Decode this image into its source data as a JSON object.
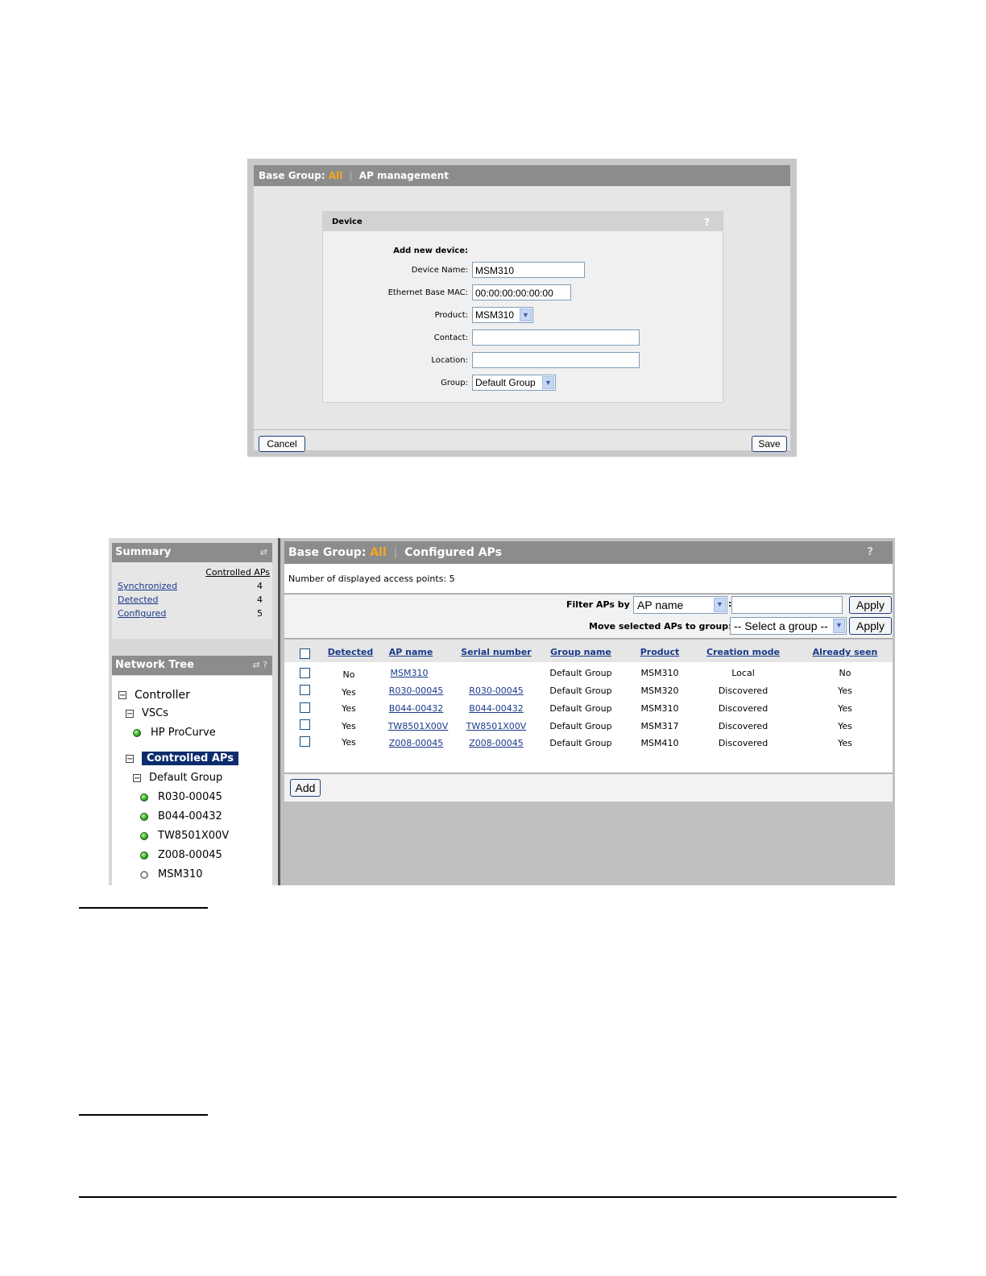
{
  "device_dialog": {
    "header": {
      "prefix": "Base Group:",
      "group": "All",
      "separator": "|",
      "title": "AP management"
    },
    "box_title": "Device",
    "help": "?",
    "section_title": "Add new device:",
    "fields": {
      "device_name": {
        "label": "Device Name:",
        "value": "MSM310"
      },
      "ethernet_mac": {
        "label": "Ethernet Base MAC:",
        "value": "00:00:00:00:00:00"
      },
      "product": {
        "label": "Product:",
        "value": "MSM310"
      },
      "contact": {
        "label": "Contact:",
        "value": ""
      },
      "location": {
        "label": "Location:",
        "value": ""
      },
      "group": {
        "label": "Group:",
        "value": "Default Group"
      }
    },
    "cancel_label": "Cancel",
    "save_label": "Save"
  },
  "summary": {
    "title": "Summary",
    "column_header": "Controlled APs",
    "rows": [
      {
        "label": "Synchronized",
        "value": "4"
      },
      {
        "label": "Detected",
        "value": "4"
      },
      {
        "label": "Configured",
        "value": "5"
      }
    ]
  },
  "network_tree": {
    "title": "Network Tree",
    "help": "?",
    "controller": "Controller",
    "vscs": "VSCs",
    "vsc_item": "HP ProCurve",
    "controlled_aps": "Controlled APs",
    "default_group": "Default Group",
    "aps": [
      {
        "name": "R030-00045",
        "status": "online"
      },
      {
        "name": "B044-00432",
        "status": "online"
      },
      {
        "name": "TW8501X00V",
        "status": "online"
      },
      {
        "name": "Z008-00045",
        "status": "online"
      },
      {
        "name": "MSM310",
        "status": "offline"
      }
    ]
  },
  "configured_aps": {
    "header": {
      "prefix": "Base Group:",
      "group": "All",
      "separator": "|",
      "title": "Configured APs"
    },
    "help": "?",
    "count_text": "Number of displayed access points: 5",
    "filter_label": "Filter APs by",
    "filter_select": "AP name",
    "colon": ":",
    "filter_value": "",
    "apply_label": "Apply",
    "move_label": "Move selected APs to group:",
    "move_select": "-- Select a group --",
    "columns": [
      "Detected",
      "AP name",
      "Serial number",
      "Group name",
      "Product",
      "Creation mode",
      "Already seen"
    ],
    "rows": [
      [
        "No",
        "MSM310",
        "",
        "Default Group",
        "MSM310",
        "Local",
        "No"
      ],
      [
        "Yes",
        "R030-00045",
        "R030-00045",
        "Default Group",
        "MSM320",
        "Discovered",
        "Yes"
      ],
      [
        "Yes",
        "B044-00432",
        "B044-00432",
        "Default Group",
        "MSM310",
        "Discovered",
        "Yes"
      ],
      [
        "Yes",
        "TW8501X00V",
        "TW8501X00V",
        "Default Group",
        "MSM317",
        "Discovered",
        "Yes"
      ],
      [
        "Yes",
        "Z008-00045",
        "Z008-00045",
        "Default Group",
        "MSM410",
        "Discovered",
        "Yes"
      ]
    ],
    "add_label": "Add"
  },
  "icons": {
    "help": "question-mark-icon",
    "panel_toggle": "panel-toggle-icon",
    "dropdown": "chevron-down-icon",
    "status_online": "green-status-dot-icon",
    "status_offline": "grey-status-dot-icon",
    "collapse": "collapse-minus-icon"
  },
  "colors": {
    "header_gray": "#8c8c8c",
    "highlight_orange": "#f6a623",
    "link_blue": "#1a3a8a",
    "selected_navy": "#0c2c6e"
  }
}
